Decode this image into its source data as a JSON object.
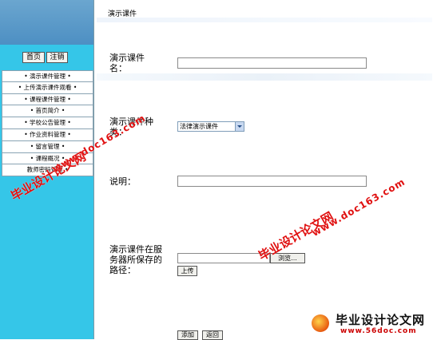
{
  "sidebar": {
    "home_button": "首页",
    "logout_button": "注销",
    "menu": [
      "• 演示课件管理 •",
      "• 上传演示课件观看 •",
      "• 课程课件管理 •",
      "• 首页简介 •",
      "• 学校公告管理 •",
      "• 作业资料管理 •",
      "• 留言管理 •",
      "• 课程概况 •",
      "教师密码管理 •"
    ]
  },
  "main": {
    "title": "演示课件",
    "name_label": "演示课件名：",
    "name_value": "",
    "kind_label": "演示课件种类：",
    "kind_selected": "法律演示课件",
    "desc_label": "说明：",
    "desc_value": "",
    "path_label": "演示课件在服务器所保存的路径：",
    "path_value": "",
    "browse_button": "浏览...",
    "upload_button": "上传",
    "add_button": "添加",
    "back_button": "返回"
  },
  "watermark": {
    "text_cn": "毕业设计论文网",
    "url": "www.doc163.com",
    "corner_cn": "毕业设计论文网",
    "corner_url": "www.56doc.com",
    "color": "#e01010"
  }
}
